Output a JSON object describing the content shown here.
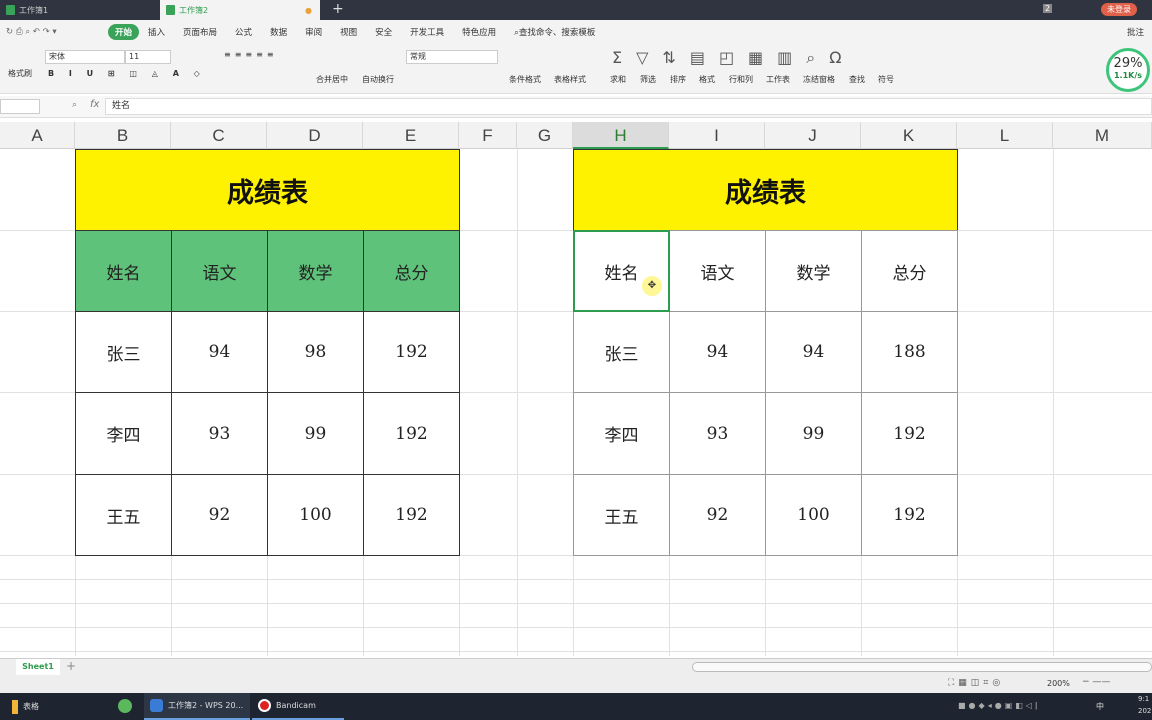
{
  "tabs": [
    {
      "label": "工作簿1"
    },
    {
      "label": "工作簿2"
    }
  ],
  "tabbar_right": {
    "badge": "2",
    "login": "未登录"
  },
  "menu": [
    "开始",
    "插入",
    "页面布局",
    "公式",
    "数据",
    "审阅",
    "视图",
    "安全",
    "开发工具",
    "特色应用"
  ],
  "search_cmd": "查找命令、搜索模板",
  "comment": "批注",
  "ribbon": {
    "format_painter": "格式刷",
    "font": "宋体",
    "size": "11",
    "merge": "合并居中",
    "wrap": "自动换行",
    "numfmt": "常规",
    "cond": "条件格式",
    "tablestyle": "表格样式",
    "sum": "求和",
    "filter": "筛选",
    "sort": "排序",
    "format": "格式",
    "rowcol": "行和列",
    "sheet": "工作表",
    "freeze": "冻结窗格",
    "find": "查找",
    "symbol": "符号"
  },
  "speed": {
    "percent": "29%",
    "rate": "1.1K/s"
  },
  "formula": {
    "fx": "fx",
    "value": "姓名"
  },
  "columns": [
    "A",
    "B",
    "C",
    "D",
    "E",
    "F",
    "G",
    "H",
    "I",
    "J",
    "K",
    "L",
    "M"
  ],
  "selected_column": "H",
  "table_left": {
    "title": "成绩表",
    "headers": [
      "姓名",
      "语文",
      "数学",
      "总分"
    ],
    "rows": [
      [
        "张三",
        "94",
        "98",
        "192"
      ],
      [
        "李四",
        "93",
        "99",
        "192"
      ],
      [
        "王五",
        "92",
        "100",
        "192"
      ]
    ]
  },
  "table_right": {
    "title": "成绩表",
    "headers": [
      "姓名",
      "语文",
      "数学",
      "总分"
    ],
    "rows": [
      [
        "张三",
        "94",
        "94",
        "188"
      ],
      [
        "李四",
        "93",
        "99",
        "192"
      ],
      [
        "王五",
        "92",
        "100",
        "192"
      ]
    ]
  },
  "colors": {
    "title_bg": "#fff200",
    "header_bg": "#5ec27a",
    "accent": "#3aa35a"
  },
  "sheet": {
    "name": "Sheet1",
    "add": "+"
  },
  "status": {
    "zoom": "200%"
  },
  "taskbar": {
    "items": [
      "表格",
      "工作簿2 - WPS 20...",
      "Bandicam"
    ],
    "ime": "中",
    "time": "9:1",
    "date": "202"
  }
}
